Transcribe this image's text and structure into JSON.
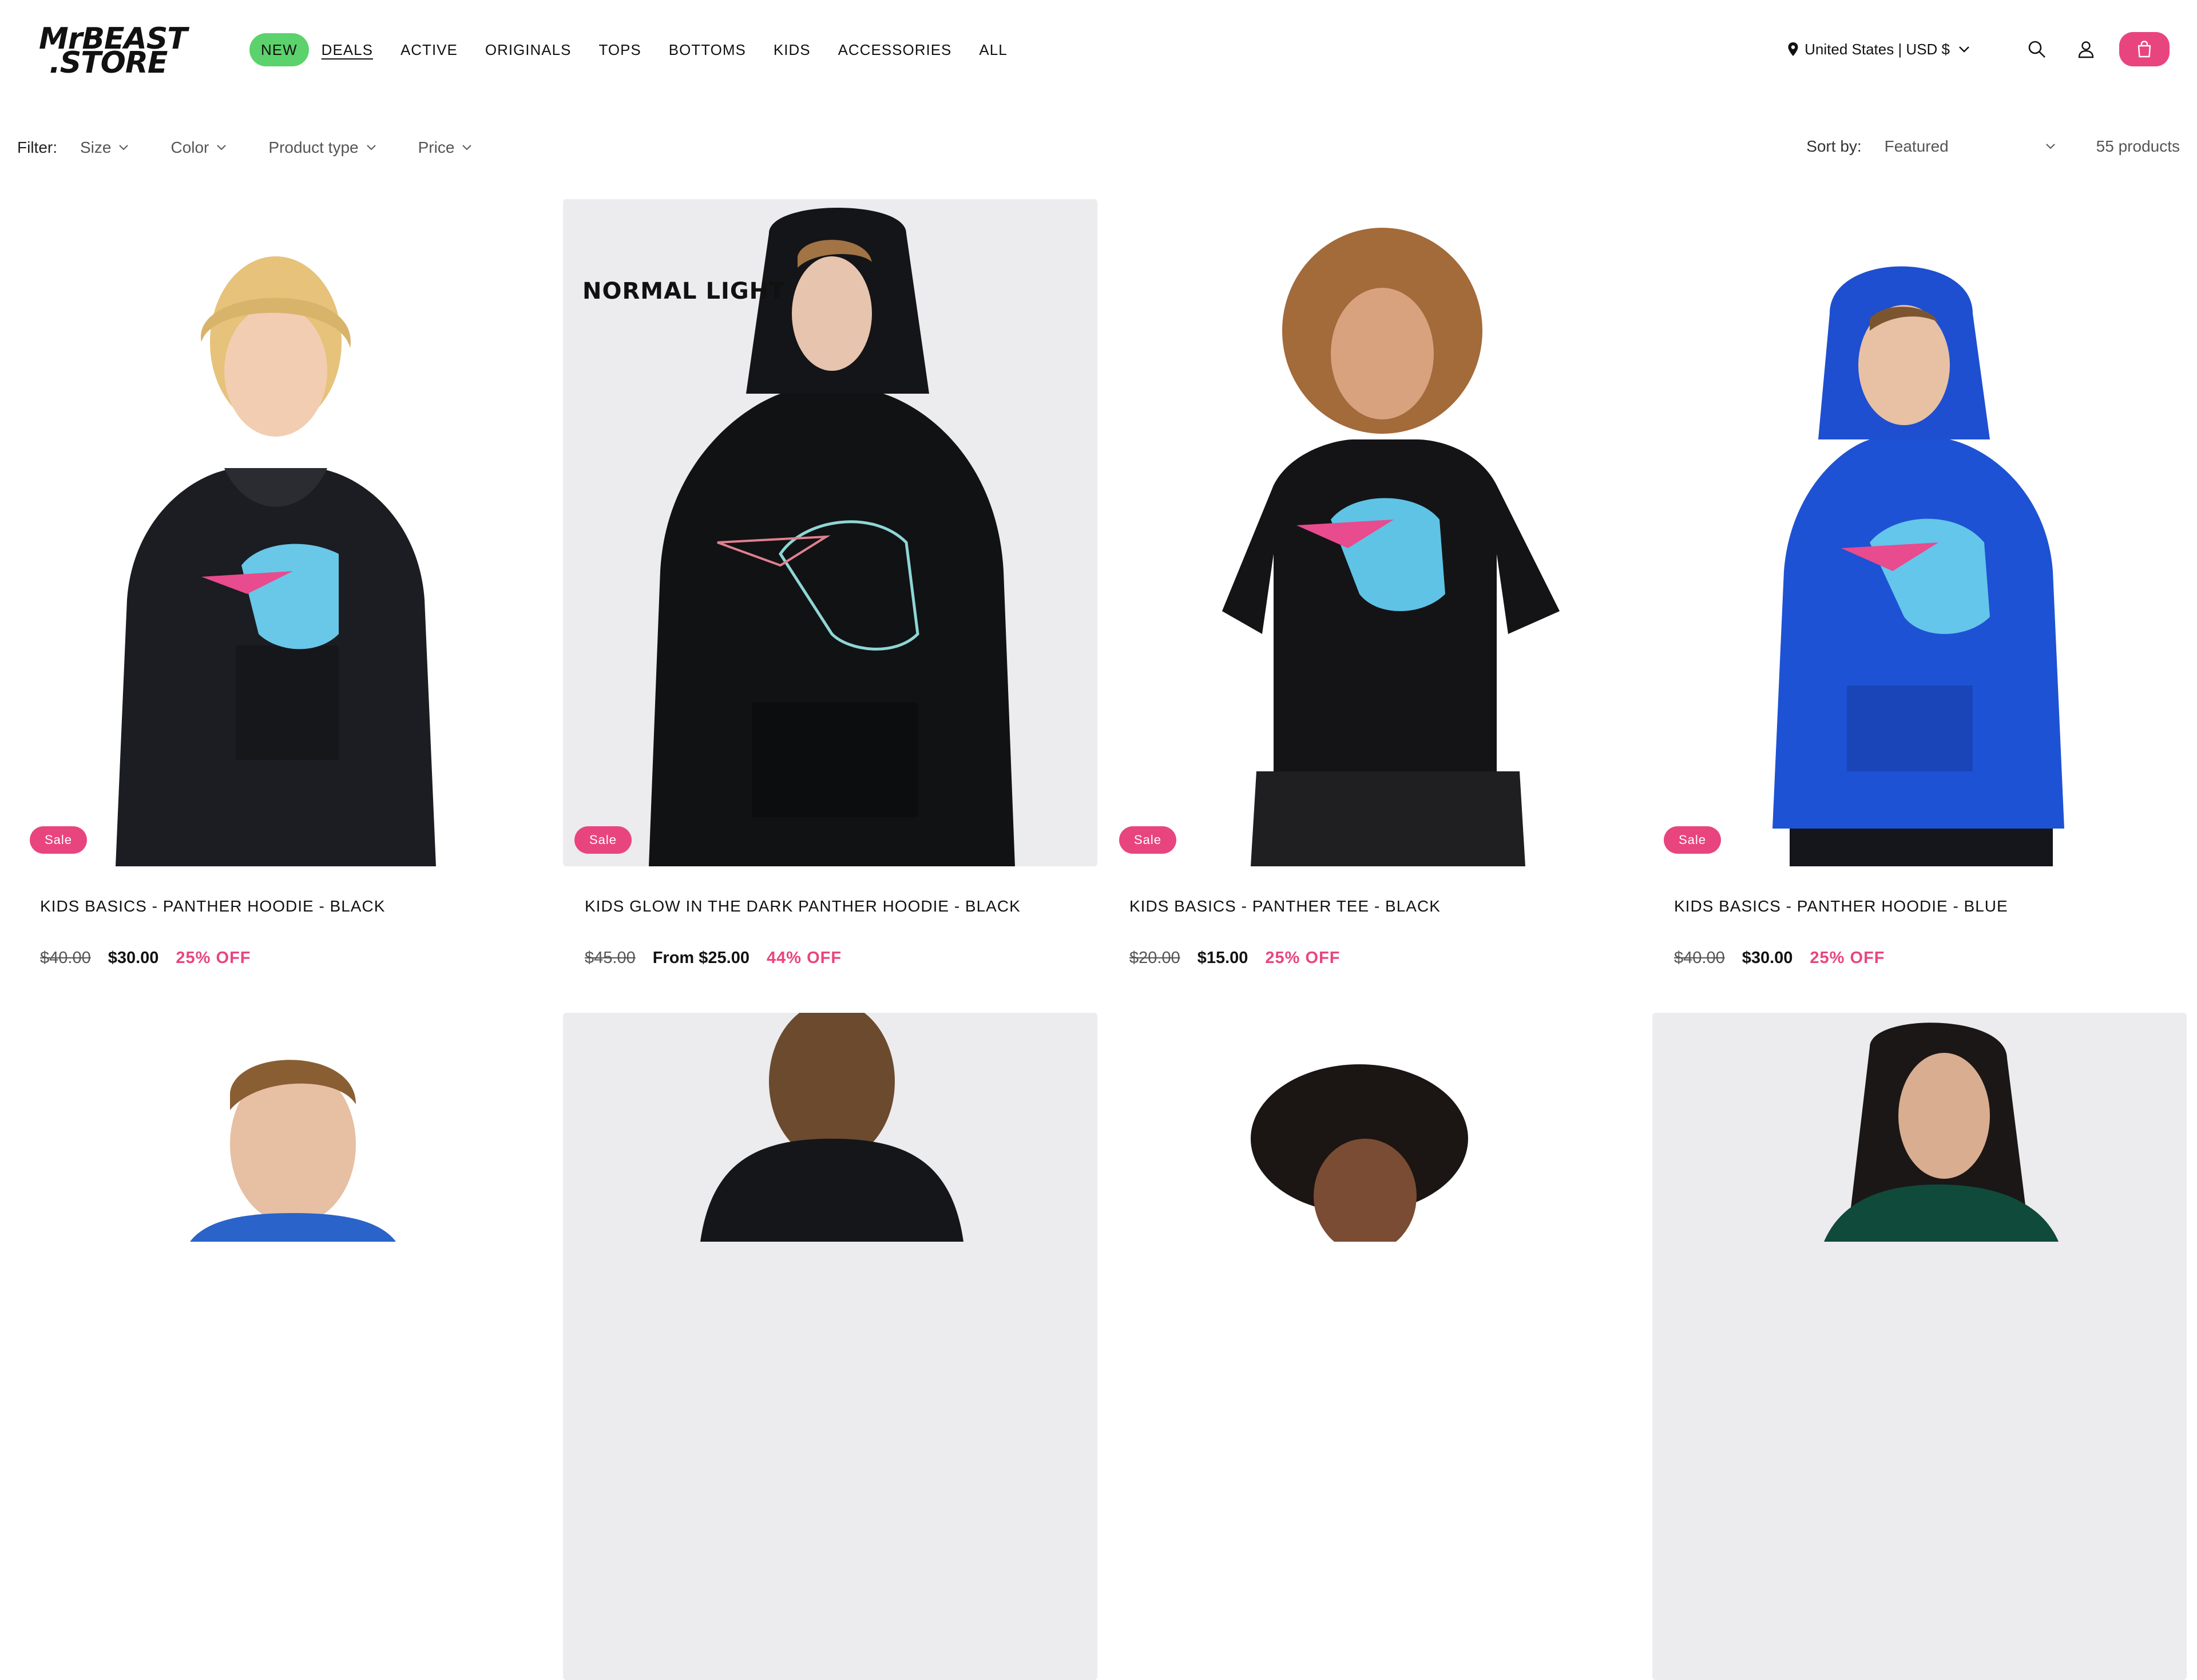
{
  "brand": {
    "logo_line1": "MrBEAST",
    "logo_line2": ".STORE"
  },
  "nav": [
    {
      "label": "NEW"
    },
    {
      "label": "DEALS"
    },
    {
      "label": "ACTIVE"
    },
    {
      "label": "ORIGINALS"
    },
    {
      "label": "TOPS"
    },
    {
      "label": "BOTTOMS"
    },
    {
      "label": "KIDS"
    },
    {
      "label": "ACCESSORIES"
    },
    {
      "label": "ALL"
    }
  ],
  "header": {
    "country": "United States | USD $",
    "icons": [
      "location-pin-icon",
      "search-icon",
      "account-icon",
      "cart-icon"
    ],
    "accent_color": "#e8457f",
    "new_pill_color": "#5bd26b"
  },
  "filters": {
    "label": "Filter:",
    "items": [
      "Size",
      "Color",
      "Product type",
      "Price"
    ]
  },
  "sort": {
    "label": "Sort by:",
    "selected": "Featured",
    "count": "55 products"
  },
  "products": [
    {
      "title": "KIDS BASICS - PANTHER HOODIE - BLACK",
      "badge": "Sale",
      "was": "$40.00",
      "now": "$30.00",
      "off": "25% OFF"
    },
    {
      "title": "KIDS GLOW IN THE DARK PANTHER HOODIE - BLACK",
      "badge": "Sale",
      "overlay_text": "NORMAL LIGHT",
      "was": "$45.00",
      "now": "From $25.00",
      "off": "44% OFF"
    },
    {
      "title": "KIDS BASICS - PANTHER TEE - BLACK",
      "badge": "Sale",
      "was": "$20.00",
      "now": "$15.00",
      "off": "25% OFF"
    },
    {
      "title": "KIDS BASICS - PANTHER HOODIE - BLUE",
      "badge": "Sale",
      "was": "$40.00",
      "now": "$30.00",
      "off": "25% OFF"
    }
  ]
}
